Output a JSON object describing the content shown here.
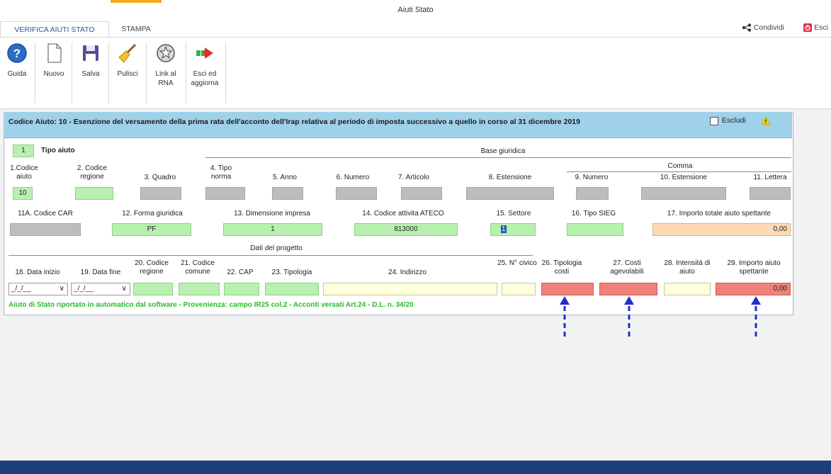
{
  "window": {
    "title": "Aiuti Stato"
  },
  "tabs": {
    "verifica": "VERIFICA AIUTI STATO",
    "stampa": "STAMPA"
  },
  "topright": {
    "share": "Condividi",
    "exit": "Esci"
  },
  "ribbon": [
    {
      "label": "Guida",
      "icon": "help-icon"
    },
    {
      "label": "Nuovo",
      "icon": "new-document-icon"
    },
    {
      "label": "Salva",
      "icon": "save-icon"
    },
    {
      "label": "Pulisci",
      "icon": "broom-icon"
    },
    {
      "label": "Link al RNA",
      "icon": "emblem-icon"
    },
    {
      "label": "Esci ed aggiorna",
      "icon": "exit-arrow-icon"
    }
  ],
  "form": {
    "header": "Codice Aiuto: 10 - Esenzione del versamento della prima rata dell'acconto dell'Irap relativa al periodo di imposta successivo a quello in corso al 31 dicembre 2019",
    "escludi": "Escludi",
    "tipo_num": "1",
    "tipo_label": "Tipo aiuto",
    "base_giuridica": "Base giuridica",
    "comma": "Comma",
    "l1": "1.Codice aiuto",
    "l2": "2. Codice regione",
    "l3": "3. Quadro",
    "l4": "4. Tipo norma",
    "l5": "5. Anno",
    "l6": "6. Numero",
    "l7": "7. Articolo",
    "l8": "8. Estensione",
    "l9": "9. Numero",
    "l10": "10. Estensione",
    "l11": "11. Lettera",
    "v1": "10",
    "l11a": "11A. Codice CAR",
    "l12": "12. Forma giuridica",
    "l13": "13. Dimensione impresa",
    "l14": "14. Codice attivita ATECO",
    "l15": "15. Settore",
    "l16": "16. Tipo SIEG",
    "l17": "17. Importo totale aiuto spettante",
    "v12": "PF",
    "v13": "1",
    "v14": "813000",
    "v15": "1",
    "v17": "0,00",
    "dati_progetto": "Dati del progetto",
    "l18": "18. Data inizio",
    "l19": "19. Data fine",
    "l20": "20. Codice regione",
    "l21": "21. Codice comune",
    "l22": "22. CAP",
    "l23": "23. Tipologia",
    "l24": "24. Indirizzo",
    "l25": "25. N° civico",
    "l26": "26. Tipologia costi",
    "l27": "27. Costi agevolabili",
    "l28": "28. Intensità di aiuto",
    "l29": "29. Importo aiuto spettante",
    "date_placeholder": "_/_/__",
    "v29": "0,00",
    "footnote": "Aiuto di Stato riportato in automatico dal software - Provenienza: campo IR25 col.2 - Acconti versati Art.24 - D.L. n. 34/20"
  },
  "colors": {
    "header": "#9fd2ea",
    "green": "#b8f0b0",
    "red": "#f08078",
    "arrow": "#1f2fd0",
    "footnote": "#2eb82e"
  }
}
